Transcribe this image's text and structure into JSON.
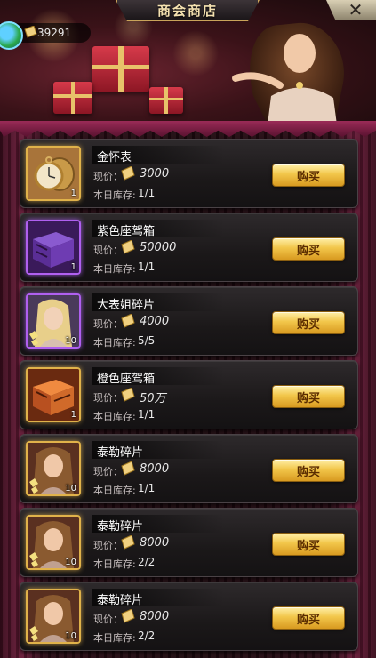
{
  "header": {
    "title": "商会商店",
    "close_label": "✕",
    "currency_amount": "39291"
  },
  "labels": {
    "price_label": "现价：",
    "stock_label": "本日库存:",
    "buy_label": "购买"
  },
  "colors": {
    "gold_frame": "#e0b24a",
    "purple_frame": "#b060f0",
    "buy_button": "#f2c64a"
  },
  "items": [
    {
      "name": "金怀表",
      "price": "3000",
      "stock": "1/1",
      "count": "1",
      "icon": "pocket-watch-icon",
      "rarity": "gold"
    },
    {
      "name": "紫色座驾箱",
      "price": "50000",
      "stock": "1/1",
      "count": "1",
      "icon": "purple-car-crate-icon",
      "rarity": "purple"
    },
    {
      "name": "大表姐碎片",
      "price": "4000",
      "stock": "5/5",
      "count": "10",
      "icon": "blonde-lady-shard-icon",
      "rarity": "purple"
    },
    {
      "name": "橙色座驾箱",
      "price": "50万",
      "stock": "1/1",
      "count": "1",
      "icon": "orange-car-crate-icon",
      "rarity": "gold"
    },
    {
      "name": "泰勒碎片",
      "price": "8000",
      "stock": "1/1",
      "count": "10",
      "icon": "brunette-lady-shard-icon",
      "rarity": "gold"
    },
    {
      "name": "泰勒碎片",
      "price": "8000",
      "stock": "2/2",
      "count": "10",
      "icon": "brunette-lady-shard-icon",
      "rarity": "gold"
    },
    {
      "name": "泰勒碎片",
      "price": "8000",
      "stock": "2/2",
      "count": "10",
      "icon": "brunette-lady-shard-icon",
      "rarity": "gold"
    }
  ]
}
